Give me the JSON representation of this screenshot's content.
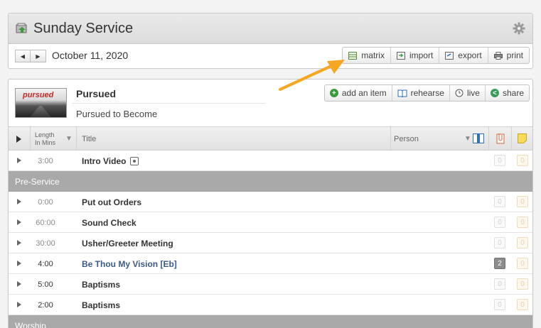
{
  "header": {
    "title": "Sunday Service",
    "date": "October 11, 2020",
    "prev_label": "◀",
    "next_label": "▶",
    "toolbar": [
      {
        "label": "matrix",
        "icon": "matrix-icon"
      },
      {
        "label": "import",
        "icon": "import-icon"
      },
      {
        "label": "export",
        "icon": "export-icon"
      },
      {
        "label": "print",
        "icon": "printer-icon"
      }
    ]
  },
  "plan": {
    "thumbnail_text": "pursued",
    "title": "Pursued",
    "subtitle": "Pursued to Become",
    "actions": [
      {
        "label": "add an item",
        "icon": "plus-icon"
      },
      {
        "label": "rehearse",
        "icon": "book-icon"
      },
      {
        "label": "live",
        "icon": "clock-icon"
      },
      {
        "label": "share",
        "icon": "share-icon"
      }
    ]
  },
  "table": {
    "col_length_line1": "Length",
    "col_length_line2": "In Mins",
    "col_title": "Title",
    "col_person": "Person",
    "rows": [
      {
        "type": "item",
        "length": "3:00",
        "title": "Intro Video",
        "video": true,
        "count_a": "0",
        "count_b": "0"
      },
      {
        "type": "section",
        "title": "Pre-Service"
      },
      {
        "type": "item",
        "length": "0:00",
        "title": "Put out Orders",
        "count_a": "0",
        "count_b": "0"
      },
      {
        "type": "item",
        "length": "60:00",
        "title": "Sound Check",
        "count_a": "0",
        "count_b": "0"
      },
      {
        "type": "item",
        "length": "30:00",
        "title": "Usher/Greeter Meeting",
        "count_a": "0",
        "count_b": "0"
      },
      {
        "type": "song",
        "length": "4:00",
        "title": "Be Thou My Vision [Eb]",
        "count_a": "2",
        "count_b": "0"
      },
      {
        "type": "item",
        "length": "5:00",
        "title": "Baptisms",
        "count_a": "0",
        "count_b": "0"
      },
      {
        "type": "item",
        "length": "2:00",
        "title": "Baptisms",
        "count_a": "0",
        "count_b": "0"
      },
      {
        "type": "section",
        "title": "Worship"
      }
    ]
  },
  "colors": {
    "accent_arrow": "#f5a623",
    "song_link": "#3b5a8a",
    "section_bg": "#a9a9a9",
    "add_green": "#3a9a3a",
    "share_green": "#3a9a5a"
  }
}
